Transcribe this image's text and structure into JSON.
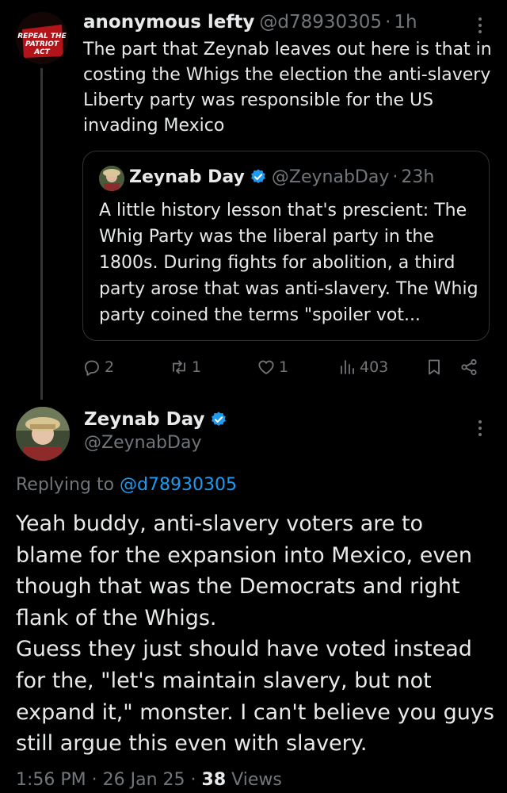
{
  "parent_tweet": {
    "avatar_text": [
      "REPEAL",
      "THE",
      "PATRIOT",
      "ACT"
    ],
    "name": "anonymous lefty",
    "handle": "@d78930305",
    "separator": "·",
    "time": "1h",
    "text": "The part that Zeynab leaves out here is that in costing the Whigs the election the anti-slavery Liberty party was responsible for the US invading Mexico",
    "quote": {
      "name": "Zeynab Day",
      "handle": "@ZeynabDay",
      "separator": "·",
      "time": "23h",
      "text": "A little history lesson that's prescient: The Whig Party was the liberal party in the 1800s. During fights for abolition, a third party arose that was anti-slavery. The Whig party coined the terms \"spoiler vot..."
    },
    "actions": {
      "replies": "2",
      "reposts": "1",
      "likes": "1",
      "views": "403"
    }
  },
  "main_tweet": {
    "name": "Zeynab Day",
    "handle": "@ZeynabDay",
    "replying_prefix": "Replying to",
    "replying_to": "@d78930305",
    "text_lines": [
      "Yeah buddy, anti-slavery voters are to blame for the expansion into Mexico, even though that was the Democrats and right flank of the Whigs.",
      "Guess they just should have voted instead for the, \"let's maintain slavery, but not expand it,\" monster. I can't believe you guys still argue this even with slavery."
    ],
    "time": "1:56 PM",
    "date": "26 Jan 25",
    "separator": "·",
    "views_count": "38",
    "views_label": "Views"
  },
  "colors": {
    "background": "#000000",
    "text": "#e7e9ea",
    "muted": "#71767b",
    "link": "#1d9bf0",
    "border": "#2f3336"
  },
  "icons": {
    "verified": "verified-badge-icon",
    "reply": "reply-icon",
    "repost": "repost-icon",
    "like": "like-icon",
    "views": "views-icon",
    "bookmark": "bookmark-icon",
    "share": "share-icon",
    "more": "more-icon"
  }
}
